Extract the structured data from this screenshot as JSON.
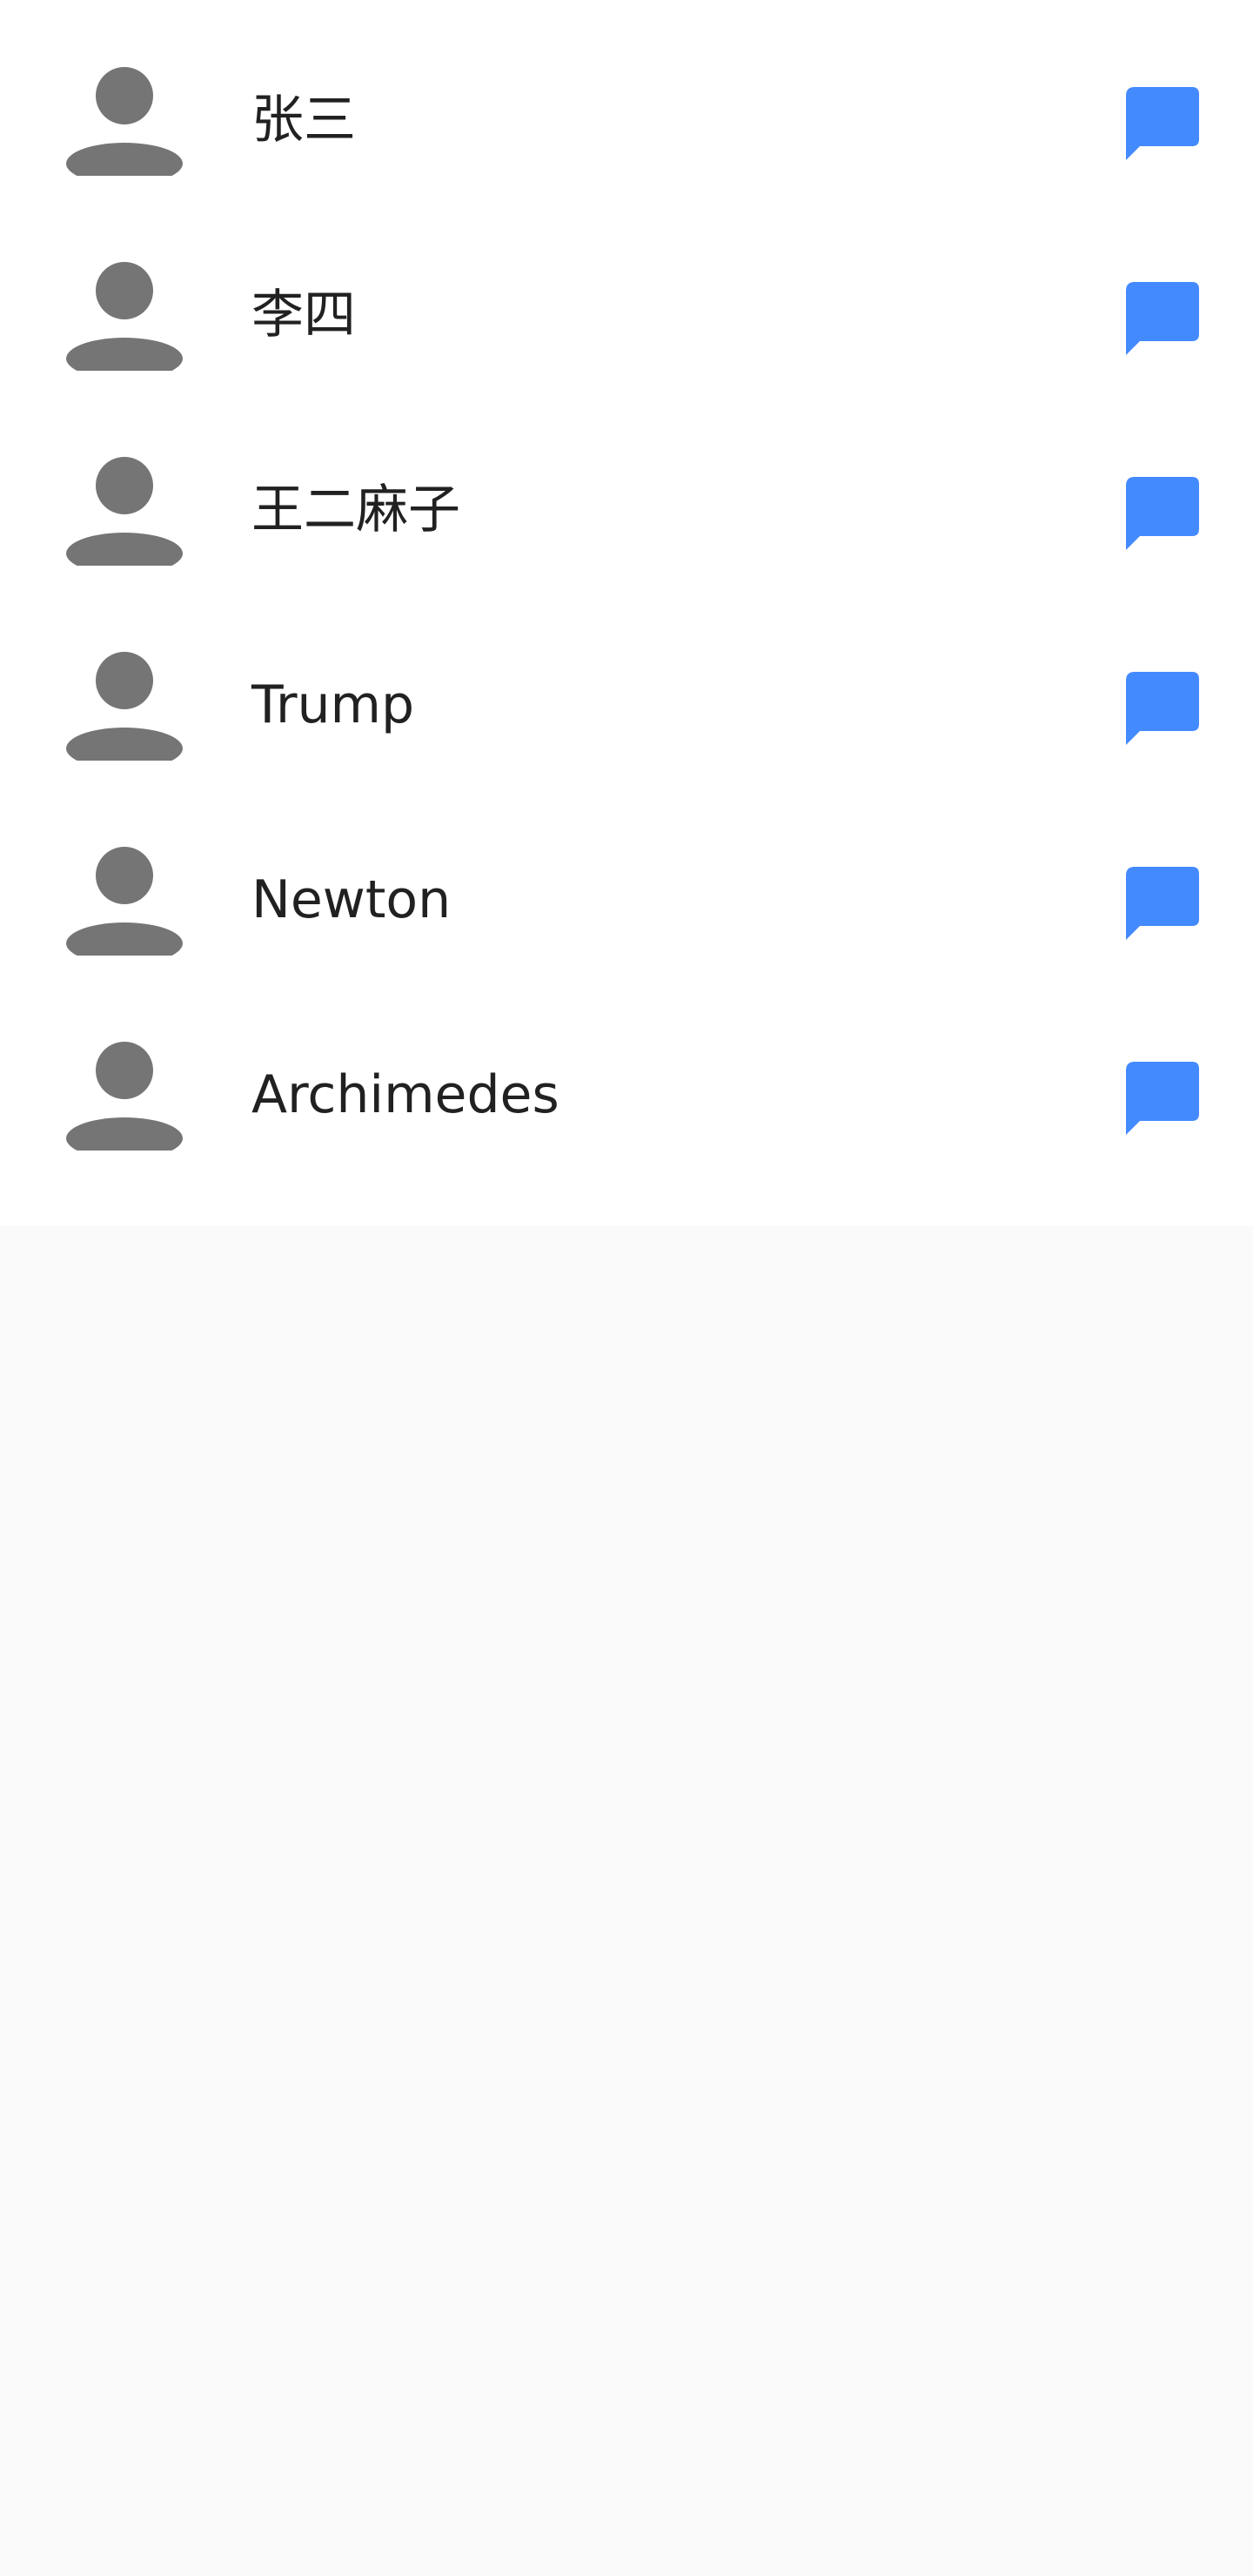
{
  "contacts": [
    {
      "name": "张三"
    },
    {
      "name": "李四"
    },
    {
      "name": "王二麻子"
    },
    {
      "name": "Trump"
    },
    {
      "name": "Newton"
    },
    {
      "name": "Archimedes"
    }
  ],
  "icons": {
    "avatar": "person-icon",
    "message": "chat-bubble-icon"
  },
  "colors": {
    "avatar_gray": "#757575",
    "message_blue": "#448aff",
    "name_text": "#212121",
    "list_background": "#ffffff",
    "page_background": "#fafafa"
  }
}
